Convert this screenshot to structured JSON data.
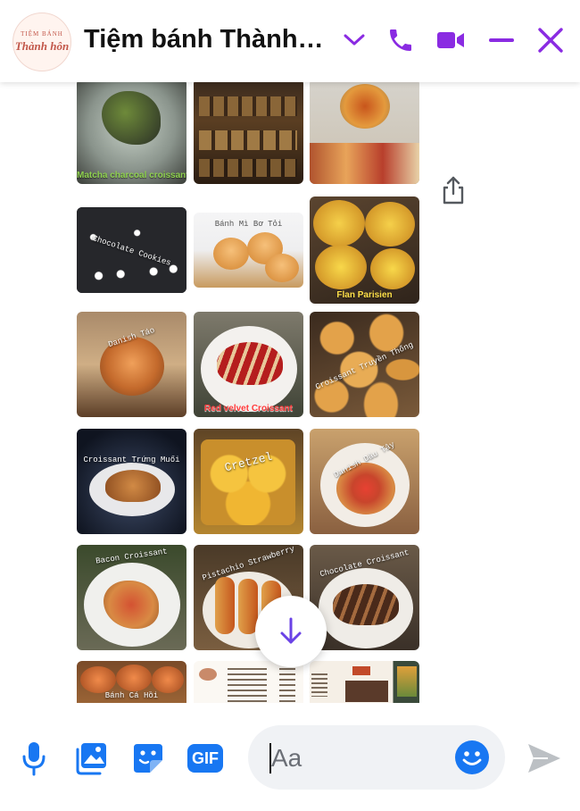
{
  "header": {
    "title": "Tiệm bánh Thành…",
    "avatar_top": "TIỆM BÁNH",
    "avatar_name": "Thành hôn"
  },
  "colors": {
    "accent": "#8a2be2",
    "messenger_blue": "#1877f2",
    "send_gray": "#bcc0c4"
  },
  "gallery": {
    "tiles": [
      {
        "caption": "Matcha charcoal croissant",
        "style": "green"
      },
      {
        "caption": "",
        "style": "none"
      },
      {
        "caption": "",
        "style": "none"
      },
      {
        "caption": "Chocolate Cookies",
        "style": "mono"
      },
      {
        "caption": "Bánh Mì Bơ Tỏi",
        "style": "mono"
      },
      {
        "caption": "Flan Parisien",
        "style": "yellow"
      },
      {
        "caption": "Danish Táo",
        "style": "mono"
      },
      {
        "caption": "Red velvet Croissant",
        "style": "white"
      },
      {
        "caption": "Croissant Truyền Thống",
        "style": "mono"
      },
      {
        "caption": "Croissant Trứng Muối",
        "style": "mono"
      },
      {
        "caption": "Cretzel",
        "style": "mono"
      },
      {
        "caption": "Danish Dâu Tây",
        "style": "mono"
      },
      {
        "caption": "Bacon Croissant",
        "style": "mono"
      },
      {
        "caption": "Pistachio Strawberry",
        "style": "mono"
      },
      {
        "caption": "Chocolate Croissant",
        "style": "mono"
      },
      {
        "caption": "Bánh Cá Hồi",
        "style": "mono"
      },
      {
        "caption": "",
        "style": "none"
      },
      {
        "caption": "",
        "style": "none"
      }
    ]
  },
  "icons": {
    "header": [
      "chevron-down-icon",
      "phone-icon",
      "video-camera-icon",
      "minimize-icon",
      "close-icon"
    ],
    "composer": [
      "microphone-icon",
      "photo-icon",
      "sticker-icon",
      "gif-icon",
      "emoji-icon",
      "send-icon"
    ],
    "gif_label": "GIF"
  },
  "composer": {
    "placeholder": "Aa"
  }
}
